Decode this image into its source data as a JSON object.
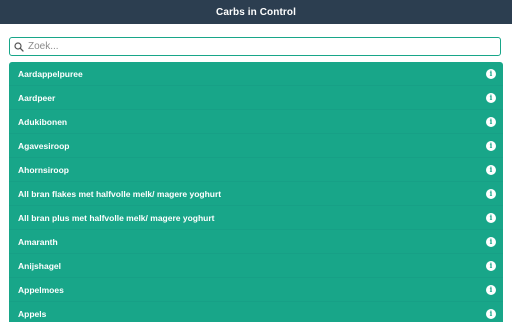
{
  "header": {
    "title": "Carbs in Control"
  },
  "search": {
    "placeholder": "Zoek...",
    "value": ""
  },
  "list": {
    "items": [
      {
        "label": "Aardappelpuree",
        "icon": "info-icon"
      },
      {
        "label": "Aardpeer",
        "icon": "info-icon"
      },
      {
        "label": "Adukibonen",
        "icon": "info-icon"
      },
      {
        "label": "Agavesiroop",
        "icon": "info-icon"
      },
      {
        "label": "Ahornsiroop",
        "icon": "info-icon"
      },
      {
        "label": "All bran flakes met halfvolle melk/ magere yoghurt",
        "icon": "info-icon"
      },
      {
        "label": "All bran plus met halfvolle melk/ magere yoghurt",
        "icon": "info-icon"
      },
      {
        "label": "Amaranth",
        "icon": "info-icon"
      },
      {
        "label": "Anijshagel",
        "icon": "info-icon"
      },
      {
        "label": "Appelmoes",
        "icon": "info-icon"
      },
      {
        "label": "Appels",
        "icon": "info-icon"
      }
    ]
  },
  "colors": {
    "header_bg": "#2c3e50",
    "accent": "#18a689",
    "text_on_accent": "#ffffff"
  }
}
